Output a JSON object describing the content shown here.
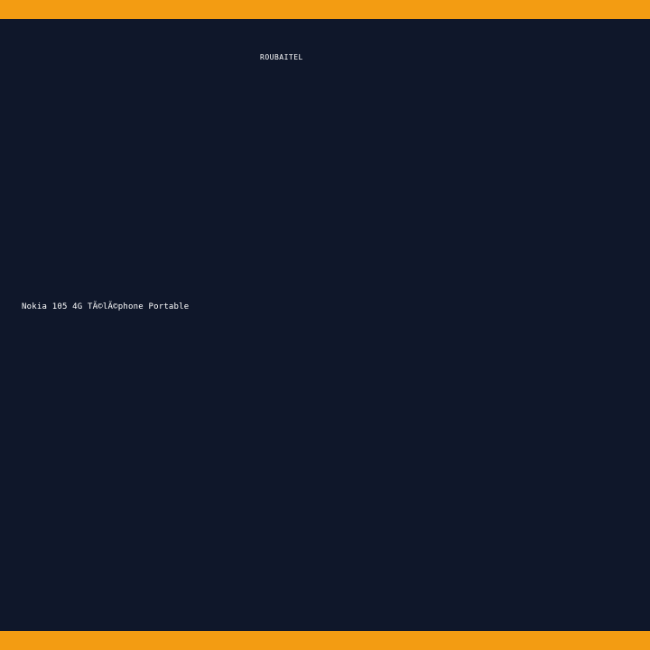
{
  "brand": {
    "name": "ROUBAITEL"
  },
  "product": {
    "title": "Nokia 105 4G TÃ©lÃ©phone Portable"
  },
  "colors": {
    "background": "#0f172a",
    "accent_bar": "#f39c12",
    "text": "#ffffff"
  }
}
